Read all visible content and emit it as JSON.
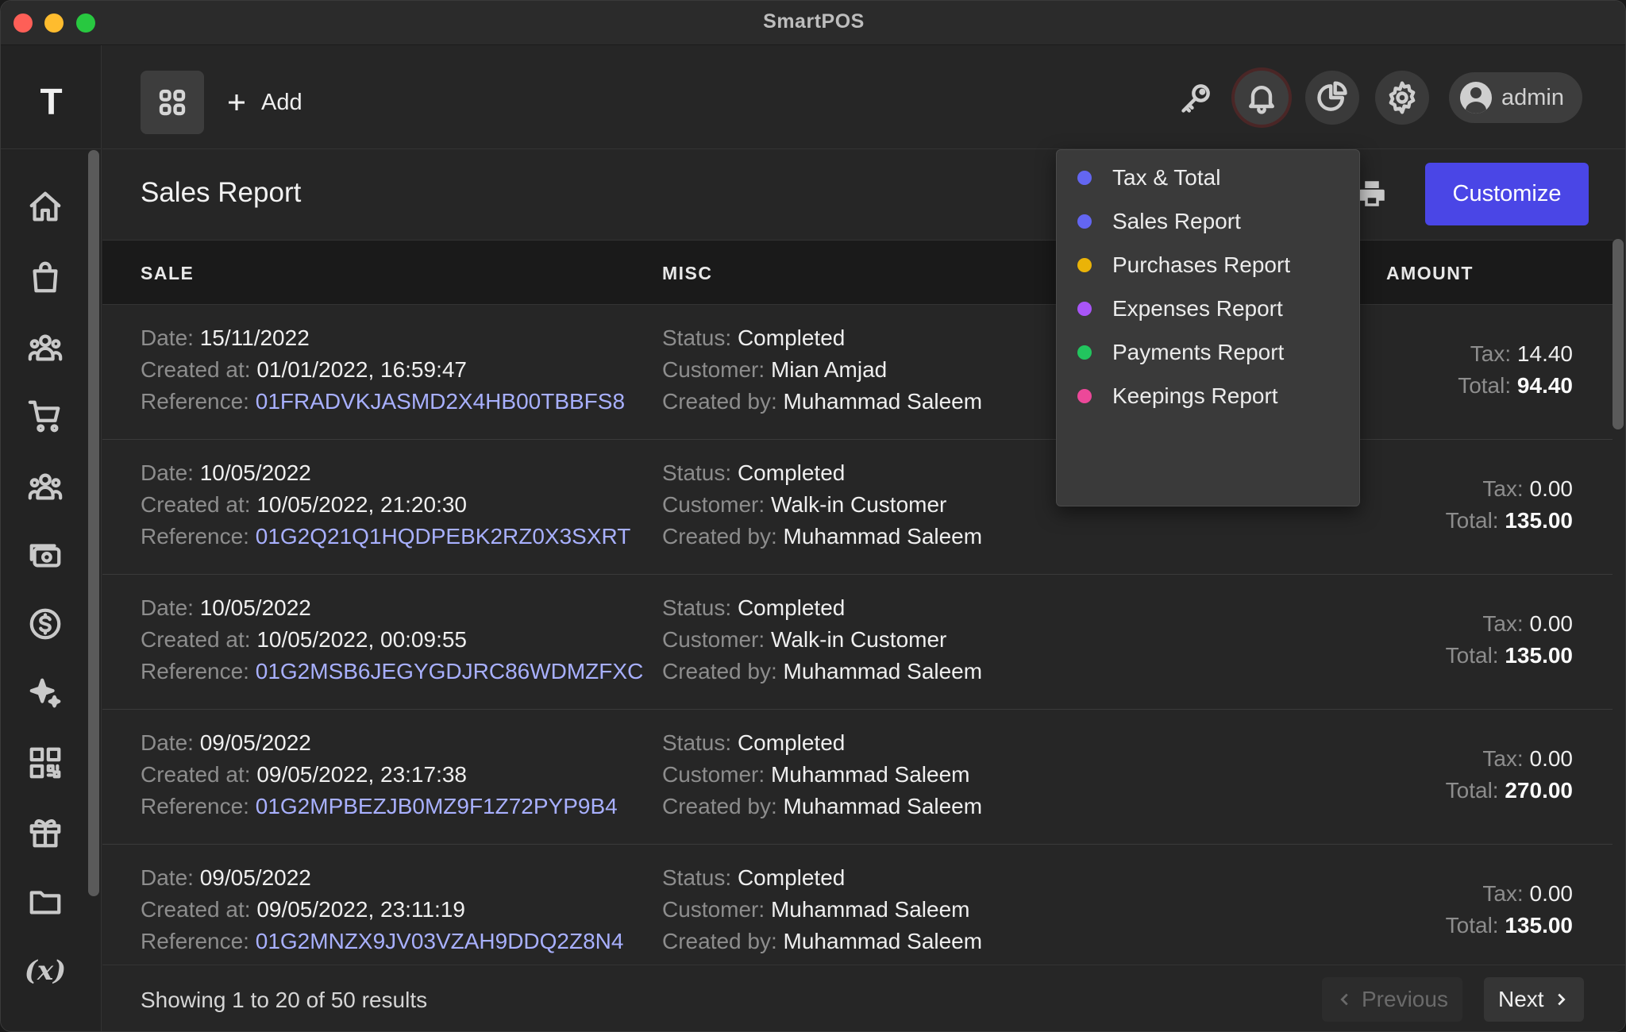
{
  "window": {
    "title": "SmartPOS"
  },
  "sidebar": {
    "logo": "T",
    "items": [
      {
        "icon": "home-icon"
      },
      {
        "icon": "shopping-bag-icon"
      },
      {
        "icon": "users-icon"
      },
      {
        "icon": "cart-icon"
      },
      {
        "icon": "customers-icon"
      },
      {
        "icon": "cash-icon"
      },
      {
        "icon": "dollar-icon"
      },
      {
        "icon": "sparkles-icon"
      },
      {
        "icon": "qr-code-icon"
      },
      {
        "icon": "gift-icon"
      },
      {
        "icon": "folder-icon"
      },
      {
        "icon": "variable-icon",
        "text": "(x)"
      }
    ]
  },
  "topbar": {
    "add_label": "Add",
    "user_label": "admin"
  },
  "page": {
    "title": "Sales Report",
    "customize_label": "Customize"
  },
  "table": {
    "headers": {
      "sale": "SALE",
      "misc": "MISC",
      "amount": "AMOUNT"
    },
    "labels": {
      "date": "Date:",
      "created_at": "Created at:",
      "reference": "Reference:",
      "status": "Status:",
      "customer": "Customer:",
      "created_by": "Created by:",
      "tax": "Tax:",
      "total": "Total:"
    },
    "rows": [
      {
        "date": "15/11/2022",
        "created_at": "01/01/2022, 16:59:47",
        "reference": "01FRADVKJASMD2X4HB00TBBFS8",
        "status": "Completed",
        "customer": "Mian Amjad",
        "created_by": "Muhammad Saleem",
        "tax": "14.40",
        "total": "94.40"
      },
      {
        "date": "10/05/2022",
        "created_at": "10/05/2022, 21:20:30",
        "reference": "01G2Q21Q1HQDPEBK2RZ0X3SXRT",
        "status": "Completed",
        "customer": "Walk-in Customer",
        "created_by": "Muhammad Saleem",
        "tax": "0.00",
        "total": "135.00"
      },
      {
        "date": "10/05/2022",
        "created_at": "10/05/2022, 00:09:55",
        "reference": "01G2MSB6JEGYGDJRC86WDMZFXC",
        "status": "Completed",
        "customer": "Walk-in Customer",
        "created_by": "Muhammad Saleem",
        "tax": "0.00",
        "total": "135.00"
      },
      {
        "date": "09/05/2022",
        "created_at": "09/05/2022, 23:17:38",
        "reference": "01G2MPBEZJB0MZ9F1Z72PYP9B4",
        "status": "Completed",
        "customer": "Muhammad Saleem",
        "created_by": "Muhammad Saleem",
        "tax": "0.00",
        "total": "270.00"
      },
      {
        "date": "09/05/2022",
        "created_at": "09/05/2022, 23:11:19",
        "reference": "01G2MNZX9JV03VZAH9DDQ2Z8N4",
        "status": "Completed",
        "customer": "Muhammad Saleem",
        "created_by": "Muhammad Saleem",
        "tax": "0.00",
        "total": "135.00"
      }
    ]
  },
  "footer": {
    "showing": "Showing 1 to 20 of 50 results",
    "previous_label": "Previous",
    "next_label": "Next"
  },
  "dropdown": {
    "items": [
      {
        "label": "Tax & Total",
        "color": "#6366f1"
      },
      {
        "label": "Sales Report",
        "color": "#6366f1"
      },
      {
        "label": "Purchases Report",
        "color": "#eab308"
      },
      {
        "label": "Expenses Report",
        "color": "#a855f7"
      },
      {
        "label": "Payments Report",
        "color": "#22c55e"
      },
      {
        "label": "Keepings Report",
        "color": "#ec4899"
      }
    ]
  },
  "colors": {
    "accent": "#4a46e6",
    "reference_link": "#a8b0ff"
  }
}
